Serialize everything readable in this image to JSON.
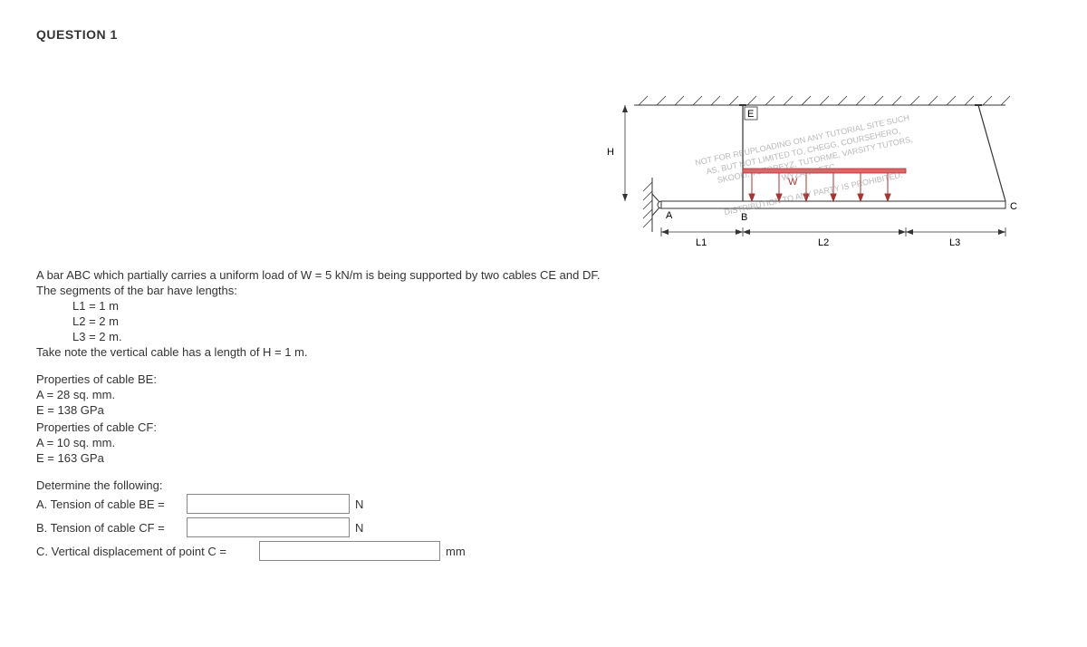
{
  "header": {
    "title": "QUESTION 1"
  },
  "problem": {
    "intro1": "A bar ABC which partially carries a uniform load of W = 5 kN/m is being supported by two cables CE and DF.",
    "intro2": "The segments of the bar have lengths:",
    "l1": "L1 = 1 m",
    "l2": "L2 = 2 m",
    "l3": "L3 = 2 m.",
    "note": "Take note the vertical cable has a length of H = 1 m."
  },
  "properties": {
    "be_header": "Properties of cable BE:",
    "be_a": "A = 28 sq. mm.",
    "be_e": "E = 138 GPa",
    "cf_header": "Properties of cable CF:",
    "cf_a": "A = 10 sq. mm.",
    "cf_e": "E = 163 GPa"
  },
  "determine": {
    "header": "Determine the following:",
    "a_label": "A. Tension of cable BE =",
    "a_unit": "N",
    "b_label": "B. Tension of cable CF =",
    "b_unit": "N",
    "c_label": "C. Vertical displacement of point C =",
    "c_unit": "mm"
  },
  "diagram": {
    "H": "H",
    "E": "E",
    "A": "A",
    "B": "B",
    "C": "C",
    "W": "W",
    "L1": "L1",
    "L2": "L2",
    "L3": "L3",
    "wm1": "NOT FOR REUPLOADING ON ANY TUTORIAL SITE SUCH",
    "wm2": "AS, BUT NOT LIMITED TO, CHEGG, COURSEHERO,",
    "wm3": "SKOOLI, TUTOREYZ, TUTORME, VARSITY TUTORS,",
    "wm4": "WYZANT, ETC.",
    "wm5": "DISTRIBUTION TO ANY PARTY IS PROHIBITED."
  }
}
